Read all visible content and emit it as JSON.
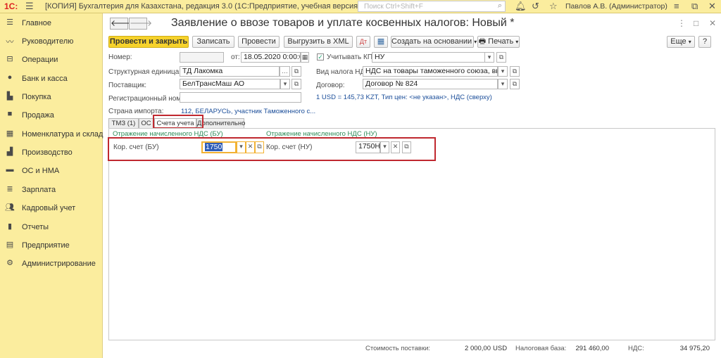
{
  "topbar": {
    "logo": "1С:",
    "title": "[КОПИЯ] Бухгалтерия для Казахстана, редакция 3.0  (1С:Предприятие, учебная версия)",
    "search_placeholder": "Поиск Ctrl+Shift+F",
    "user": "Павлов А.В. (Администратор)"
  },
  "sidebar": {
    "items": [
      {
        "label": "Главное",
        "icon": "menu-icon"
      },
      {
        "label": "Руководителю",
        "icon": "chart-trend-icon"
      },
      {
        "label": "Операции",
        "icon": "operations-icon"
      },
      {
        "label": "Банк и касса",
        "icon": "bank-icon"
      },
      {
        "label": "Покупка",
        "icon": "cart-icon"
      },
      {
        "label": "Продажа",
        "icon": "bag-icon"
      },
      {
        "label": "Номенклатура и склад",
        "icon": "grid-icon"
      },
      {
        "label": "Производство",
        "icon": "factory-icon"
      },
      {
        "label": "ОС и НМА",
        "icon": "truck-icon"
      },
      {
        "label": "Зарплата",
        "icon": "list-icon"
      },
      {
        "label": "Кадровый учет",
        "icon": "people-icon"
      },
      {
        "label": "Отчеты",
        "icon": "bar-chart-icon"
      },
      {
        "label": "Предприятие",
        "icon": "document-icon"
      },
      {
        "label": "Администрирование",
        "icon": "gear-icon"
      }
    ]
  },
  "form": {
    "title": "Заявление о ввозе товаров и уплате косвенных налогов: Новый *",
    "toolbar": {
      "post_close": "Провести и закрыть",
      "save": "Записать",
      "post": "Провести",
      "export_xml": "Выгрузить в XML",
      "create_based": "Создать на основании",
      "print": "Печать",
      "more": "Еще",
      "help": "?"
    },
    "fields": {
      "number_label": "Номер:",
      "number_value": "",
      "date_label": "от:",
      "date_value": "18.05.2020  0:00:0",
      "kpn_label": "Учитывать КПН",
      "kpn_checked": "✓",
      "kpn_value": "НУ",
      "unit_label": "Структурная единица:",
      "unit_value": "ТД Лакомка",
      "vat_type_label": "Вид налога НДС:",
      "vat_type_value": "НДС на товары таможенного союза, ввоз",
      "supplier_label": "Поставщик:",
      "supplier_value": "БелТрансМаш АО",
      "contract_label": "Договор:",
      "contract_value": "Договор № 824",
      "reg_number_label": "Регистрационный номер:",
      "reg_number_value": "",
      "rate_info": "1 USD = 145,73 KZT, Тип цен: <не указан>, НДС (сверху)",
      "country_label": "Страна импорта:",
      "country_value": "112, БЕЛАРУСЬ, участник Таможенного с..."
    },
    "tabs": [
      "ТМЗ (1)",
      "ОС",
      "Счета учета",
      "Дополнительно"
    ],
    "accounts": {
      "bu_header": "Отражение начисленного НДС (БУ)",
      "nu_header": "Отражение начисленного НДС (НУ)",
      "bu_label": "Кор. счет (БУ)",
      "bu_value": "1750",
      "nu_label": "Кор. счет (НУ)",
      "nu_value": "1750Н"
    },
    "footer": {
      "cost_label": "Стоимость поставки:",
      "cost_value": "2 000,00",
      "currency": "USD",
      "taxbase_label": "Налоговая база:",
      "taxbase_value": "291 460,00",
      "vat_label": "НДС:",
      "vat_value": "34 975,20"
    }
  }
}
